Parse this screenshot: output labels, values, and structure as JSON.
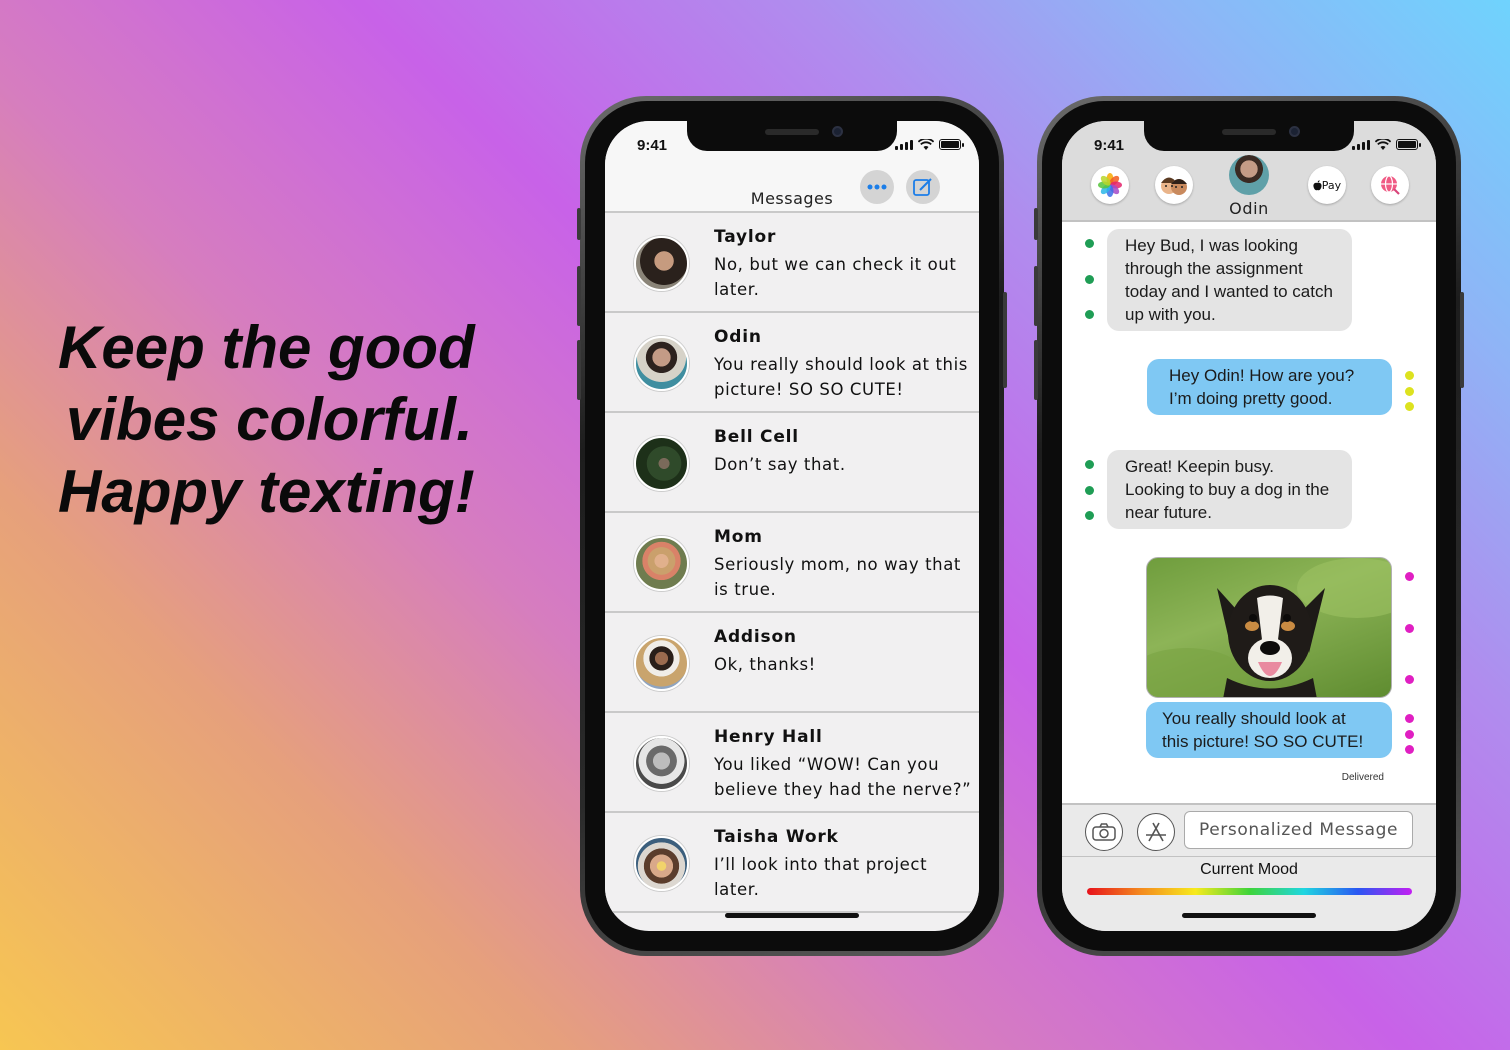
{
  "tagline": {
    "line1": "Keep the good",
    "line2": "vibes colorful.",
    "line3": "Happy texting!"
  },
  "left_phone": {
    "status_time": "9:41",
    "header_title": "Messages",
    "conversations": [
      {
        "name": "Taylor",
        "preview": "No, but we can check it out later."
      },
      {
        "name": "Odin",
        "preview": " You really should look at this picture! SO SO CUTE!"
      },
      {
        "name": "Bell Cell",
        "preview": "Don’t say that."
      },
      {
        "name": "Mom",
        "preview": "Seriously mom, no way that is true."
      },
      {
        "name": "Addison",
        "preview": "Ok, thanks!"
      },
      {
        "name": "Henry Hall",
        "preview": "You liked “WOW! Can you believe they had the nerve?”"
      },
      {
        "name": "Taisha Work",
        "preview": "I’ll look into that project later."
      }
    ]
  },
  "right_phone": {
    "status_time": "9:41",
    "contact_name": "Odin",
    "apple_pay_label": "Pay",
    "messages": [
      {
        "direction": "in",
        "text": "Hey Bud, I was looking through the assignment today and I wanted to catch up with you."
      },
      {
        "direction": "out",
        "text": "Hey Odin! How are you? I’m doing pretty good."
      },
      {
        "direction": "in",
        "text": "Great! Keepin busy. Looking to buy a dog in the near future."
      },
      {
        "direction": "out",
        "text": "You really should look at this picture! SO SO CUTE!"
      }
    ],
    "delivered_label": "Delivered",
    "input_placeholder": "Personalized Message",
    "mood_label": "Current Mood",
    "colors": {
      "incoming_dots": "#1f9d55",
      "outgoing_dots_1": "#dde21f",
      "outgoing_dots_2": "#e01fc2",
      "outgoing_bubble": "#7fc8f3",
      "incoming_bubble": "#e4e4e4"
    }
  }
}
